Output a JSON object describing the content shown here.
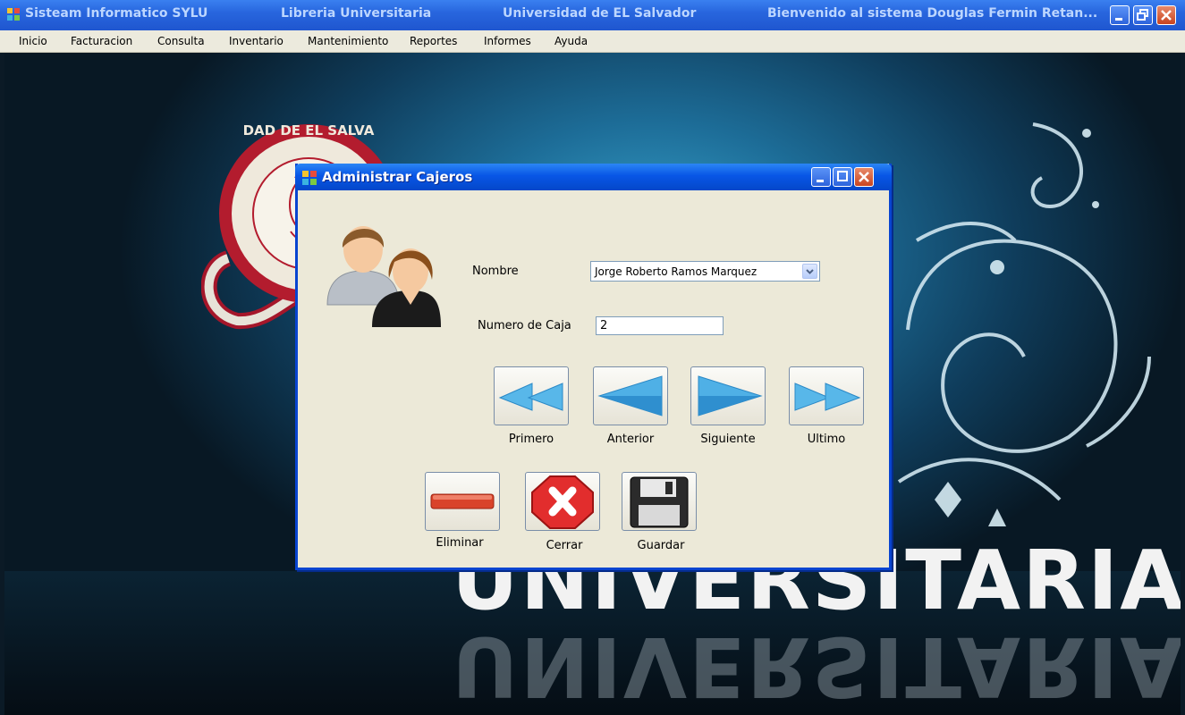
{
  "window": {
    "title_app": "Sisteam Informatico SYLU",
    "title_lib": "Libreria Universitaria",
    "title_univ": "Universidad de EL Salvador",
    "title_welcome": "Bienvenido al sistema Douglas Fermin Retan..."
  },
  "menu": {
    "items": [
      "Inicio",
      "Facturacion",
      "Consulta",
      "Inventario",
      "Mantenimiento",
      "Reportes",
      "Informes",
      "Ayuda"
    ]
  },
  "background": {
    "banner_text": "UNIVERSITARIA",
    "seal_text": "UNIVERSIDAD DE EL SALVADOR"
  },
  "dialog": {
    "title": "Administrar Cajeros",
    "nombre_label": "Nombre",
    "nombre_value": "Jorge Roberto Ramos Marquez",
    "caja_label": "Numero de Caja",
    "caja_value": "2",
    "nav": {
      "first": "Primero",
      "prev": "Anterior",
      "next": "Siguiente",
      "last": "Ultimo"
    },
    "actions": {
      "delete": "Eliminar",
      "close": "Cerrar",
      "save": "Guardar"
    }
  },
  "colors": {
    "titlebar": "#2866de",
    "dialog_bg": "#ece9d8",
    "arrow_blue": "#3aa3df"
  }
}
